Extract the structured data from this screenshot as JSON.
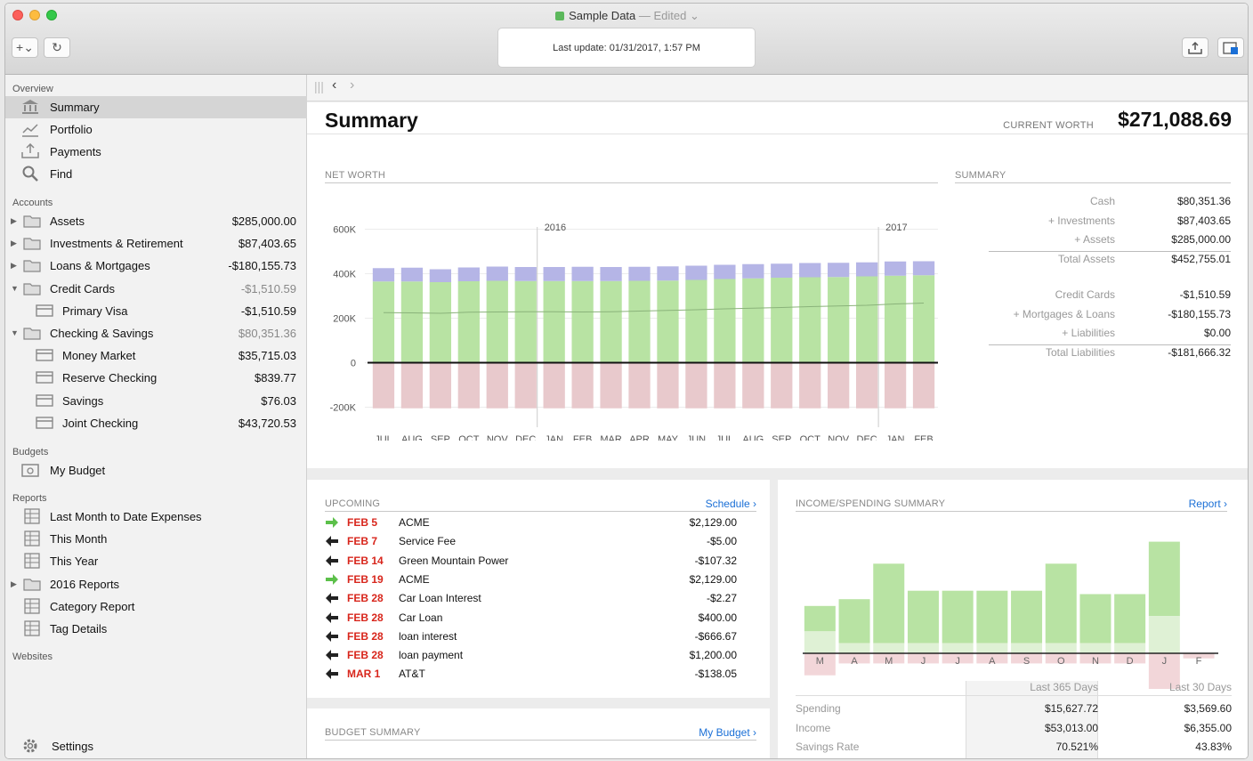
{
  "window": {
    "title": "Sample Data",
    "edited": "— Edited",
    "last_update": "Last update:  01/31/2017, 1:57 PM"
  },
  "toolbar": {
    "add_label": "+⌄",
    "refresh_label": "↻"
  },
  "sidebar": {
    "overview_header": "Overview",
    "overview": [
      {
        "label": "Summary",
        "icon": "bank-icon"
      },
      {
        "label": "Portfolio",
        "icon": "chart-icon"
      },
      {
        "label": "Payments",
        "icon": "tray-icon"
      },
      {
        "label": "Find",
        "icon": "magnifier-icon"
      }
    ],
    "accounts_header": "Accounts",
    "accounts": [
      {
        "label": "Assets",
        "amount": "$285,000.00",
        "indent": 0,
        "tri": "▶"
      },
      {
        "label": "Investments & Retirement",
        "amount": "$87,403.65",
        "indent": 0,
        "tri": "▶"
      },
      {
        "label": "Loans & Mortgages",
        "amount": "-$180,155.73",
        "indent": 0,
        "tri": "▶"
      },
      {
        "label": "Credit Cards",
        "amount": "-$1,510.59",
        "indent": 0,
        "tri": "▼",
        "dim": true
      },
      {
        "label": "Primary Visa",
        "amount": "-$1,510.59",
        "indent": 1,
        "tri": ""
      },
      {
        "label": "Checking & Savings",
        "amount": "$80,351.36",
        "indent": 0,
        "tri": "▼",
        "dim": true
      },
      {
        "label": "Money Market",
        "amount": "$35,715.03",
        "indent": 1,
        "tri": ""
      },
      {
        "label": "Reserve Checking",
        "amount": "$839.77",
        "indent": 1,
        "tri": ""
      },
      {
        "label": "Savings",
        "amount": "$76.03",
        "indent": 1,
        "tri": ""
      },
      {
        "label": "Joint Checking",
        "amount": "$43,720.53",
        "indent": 1,
        "tri": ""
      }
    ],
    "budgets_header": "Budgets",
    "budgets": [
      {
        "label": "My Budget"
      }
    ],
    "reports_header": "Reports",
    "reports": [
      {
        "label": "Last Month to Date Expenses",
        "tri": ""
      },
      {
        "label": "This Month",
        "tri": ""
      },
      {
        "label": "This Year",
        "tri": ""
      },
      {
        "label": "2016 Reports",
        "tri": "▶"
      },
      {
        "label": "Category Report",
        "tri": ""
      },
      {
        "label": "Tag Details",
        "tri": ""
      }
    ],
    "websites_header": "Websites",
    "settings_label": "Settings"
  },
  "main": {
    "title": "Summary",
    "current_worth_label": "CURRENT WORTH",
    "current_worth": "$271,088.69",
    "net_worth_label": "NET WORTH",
    "summary_label": "SUMMARY",
    "summary_rows": [
      {
        "k": "Cash",
        "v": "$80,351.36"
      },
      {
        "k": "+ Investments",
        "v": "$87,403.65"
      },
      {
        "k": "+ Assets",
        "v": "$285,000.00"
      },
      {
        "k": "Total Assets",
        "v": "$452,755.01"
      },
      {
        "k": "Credit Cards",
        "v": "-$1,510.59"
      },
      {
        "k": "+ Mortgages & Loans",
        "v": "-$180,155.73"
      },
      {
        "k": "+ Liabilities",
        "v": "$0.00"
      },
      {
        "k": "Total Liabilities",
        "v": "-$181,666.32"
      }
    ],
    "upcoming_label": "UPCOMING",
    "schedule_link": "Schedule ›",
    "upcoming": [
      {
        "date": "FEB 5",
        "payee": "ACME",
        "amount": "$2,129.00",
        "dir": "in"
      },
      {
        "date": "FEB 7",
        "payee": "Service Fee",
        "amount": "-$5.00",
        "dir": "out"
      },
      {
        "date": "FEB 14",
        "payee": "Green Mountain Power",
        "amount": "-$107.32",
        "dir": "out"
      },
      {
        "date": "FEB 19",
        "payee": "ACME",
        "amount": "$2,129.00",
        "dir": "in"
      },
      {
        "date": "FEB 28",
        "payee": "Car Loan Interest",
        "amount": "-$2.27",
        "dir": "out"
      },
      {
        "date": "FEB 28",
        "payee": "Car Loan",
        "amount": "$400.00",
        "dir": "out"
      },
      {
        "date": "FEB 28",
        "payee": "loan interest",
        "amount": "-$666.67",
        "dir": "out"
      },
      {
        "date": "FEB 28",
        "payee": "loan payment",
        "amount": "$1,200.00",
        "dir": "out"
      },
      {
        "date": "MAR 1",
        "payee": "AT&T",
        "amount": "-$138.05",
        "dir": "out"
      }
    ],
    "budget_summary_label": "BUDGET SUMMARY",
    "my_budget_link": "My Budget ›",
    "income_label": "INCOME/SPENDING SUMMARY",
    "report_link": "Report ›",
    "stats": {
      "col_a": "Last 365 Days",
      "col_b": "Last 30 Days",
      "rows": [
        {
          "k": "Spending",
          "a": "$15,627.72",
          "b": "$3,569.60"
        },
        {
          "k": "Income",
          "a": "$53,013.00",
          "b": "$6,355.00"
        },
        {
          "k": "Savings Rate",
          "a": "70.521%",
          "b": "43.83%"
        }
      ]
    }
  },
  "chart_data": [
    {
      "type": "bar",
      "categories": [
        "JUL",
        "AUG",
        "SEP",
        "OCT",
        "NOV",
        "DEC",
        "JAN",
        "FEB",
        "MAR",
        "APR",
        "MAY",
        "JUN",
        "JUL",
        "AUG",
        "SEP",
        "OCT",
        "NOV",
        "DEC",
        "JAN",
        "FEB"
      ],
      "year_markers": [
        {
          "label": "2016",
          "index": 6
        },
        {
          "label": "2017",
          "index": 18
        }
      ],
      "yticks": [
        -200000,
        0,
        200000,
        400000,
        600000
      ],
      "ytick_labels": [
        "-200K",
        "0",
        "200K",
        "400K",
        "600K"
      ],
      "ylim": [
        -230000,
        650000
      ],
      "series": [
        {
          "values": [
            365000,
            365000,
            362000,
            366000,
            368000,
            367000,
            367000,
            367000,
            367000,
            368000,
            369000,
            372000,
            376000,
            379000,
            382000,
            384000,
            385000,
            388000,
            391000,
            393000
          ],
          "color": "#b8e3a3"
        },
        {
          "values": [
            60000,
            62000,
            58000,
            62000,
            64000,
            63000,
            63000,
            64000,
            63000,
            63000,
            64000,
            64000,
            64000,
            64000,
            63000,
            64000,
            64000,
            63000,
            64000,
            63000
          ],
          "color": "#b5b5e6"
        },
        {
          "values": [
            -205000,
            -205000,
            -205000,
            -205000,
            -205000,
            -205000,
            -205000,
            -205000,
            -205000,
            -205000,
            -205000,
            -205000,
            -205000,
            -205000,
            -205000,
            -205000,
            -205000,
            -205000,
            -205000,
            -205000
          ],
          "color": "#e8c9cc"
        },
        {
          "values": [
            225000,
            224000,
            222000,
            227000,
            228000,
            229000,
            229000,
            228000,
            229000,
            232000,
            235000,
            238000,
            242000,
            245000,
            248000,
            252000,
            255000,
            258000,
            264000,
            268000
          ],
          "color": "#8ab37a"
        }
      ]
    },
    {
      "type": "bar",
      "categories": [
        "M",
        "A",
        "M",
        "J",
        "J",
        "A",
        "S",
        "O",
        "N",
        "D",
        "J",
        "F"
      ],
      "ylim": [
        -1,
        1
      ],
      "series": [
        {
          "values": [
            0.15,
            0.26,
            0.47,
            0.31,
            0.31,
            0.31,
            0.31,
            0.47,
            0.29,
            0.29,
            0.44,
            0
          ],
          "color": "#b8e3a3"
        },
        {
          "values": [
            0.13,
            0.06,
            0.06,
            0.06,
            0.06,
            0.06,
            0.06,
            0.06,
            0.06,
            0.06,
            0.22,
            0
          ],
          "color": "#dff1d5"
        },
        {
          "values": [
            -0.13,
            -0.06,
            -0.06,
            -0.06,
            -0.06,
            -0.06,
            -0.06,
            -0.06,
            -0.06,
            -0.06,
            -0.22,
            -0.03
          ],
          "color": "#f2d6d9"
        }
      ]
    }
  ]
}
